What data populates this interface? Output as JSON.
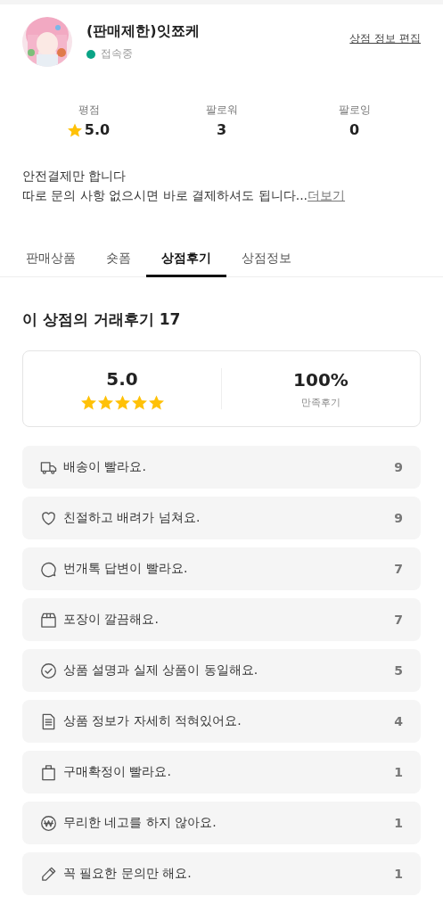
{
  "profile": {
    "name": "(판매제한)잇쬬케",
    "status": "접속중",
    "online": true,
    "edit_link": "상점 정보 편집"
  },
  "stats": [
    {
      "label": "평점",
      "value": "5.0",
      "star": true
    },
    {
      "label": "팔로워",
      "value": "3",
      "star": false
    },
    {
      "label": "팔로잉",
      "value": "0",
      "star": false
    }
  ],
  "bio": {
    "lines": [
      "안전결제만 합니다",
      "따로 문의 사항 없으시면 바로 결제하셔도 됩니다..."
    ],
    "more_link": "더보기"
  },
  "tabs": [
    {
      "label": "판매상품",
      "selected": false
    },
    {
      "label": "숏폼",
      "selected": false
    },
    {
      "label": "상점후기",
      "selected": true
    },
    {
      "label": "상점정보",
      "selected": false
    }
  ],
  "reviews": {
    "heading": "이 상점의 거래후기 17",
    "score": "5.0",
    "stars": 5,
    "satisfaction": "100%",
    "satisfaction_label": "만족후기",
    "items": [
      {
        "kind": "truck",
        "text": "배송이 빨라요.",
        "count": "9"
      },
      {
        "kind": "heart",
        "text": "친절하고 배려가 넘쳐요.",
        "count": "9"
      },
      {
        "kind": "chat",
        "text": "번개톡 답변이 빨라요.",
        "count": "7"
      },
      {
        "kind": "box",
        "text": "포장이 깔끔해요.",
        "count": "7"
      },
      {
        "kind": "check",
        "text": "상품 설명과 실제 상품이 동일해요.",
        "count": "5"
      },
      {
        "kind": "document",
        "text": "상품 정보가 자세히 적혀있어요.",
        "count": "4"
      },
      {
        "kind": "bag",
        "text": "구매확정이 빨라요.",
        "count": "1"
      },
      {
        "kind": "won",
        "text": "무리한 네고를 하지 않아요.",
        "count": "1"
      },
      {
        "kind": "pencil",
        "text": "꼭 필요한 문의만 해요.",
        "count": "1"
      }
    ]
  }
}
